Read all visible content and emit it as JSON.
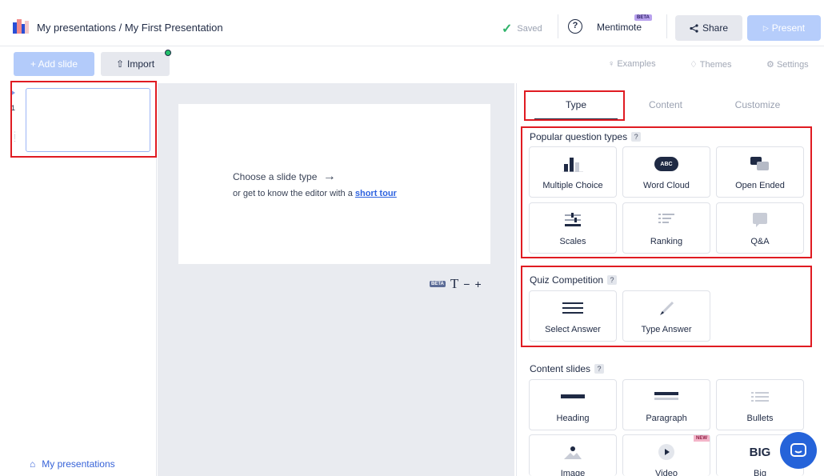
{
  "header": {
    "breadcrumb": "My presentations / My First Presentation",
    "saved_label": "Saved",
    "help_symbol": "?",
    "mentimote_label": "Mentimote",
    "mentimote_badge": "BETA",
    "share_label": "Share",
    "present_label": "Present"
  },
  "toolbar": {
    "add_slide_label": "+ Add slide",
    "import_label": "Import",
    "examples_label": "Examples",
    "themes_label": "Themes",
    "settings_label": "Settings"
  },
  "slides": {
    "current_number": "1",
    "footer_link": "My presentations"
  },
  "canvas": {
    "choose_text": "Choose a slide type",
    "tour_prefix": "or get to know the editor with a",
    "tour_link": "short tour",
    "zoom_badge": "BETA",
    "zoom_text_symbol": "T",
    "zoom_minus": "−",
    "zoom_plus": "+"
  },
  "tabs": [
    {
      "label": "Type",
      "active": true
    },
    {
      "label": "Content",
      "active": false
    },
    {
      "label": "Customize",
      "active": false
    }
  ],
  "sections": {
    "popular": {
      "title": "Popular question types",
      "help": "?",
      "cards": [
        {
          "label": "Multiple Choice",
          "icon": "bar-chart-icon"
        },
        {
          "label": "Word Cloud",
          "icon": "word-cloud-icon"
        },
        {
          "label": "Open Ended",
          "icon": "speech-bubbles-icon"
        },
        {
          "label": "Scales",
          "icon": "scales-icon"
        },
        {
          "label": "Ranking",
          "icon": "ranking-icon"
        },
        {
          "label": "Q&A",
          "icon": "qa-icon"
        }
      ],
      "word_cloud_icon_text": "ABC"
    },
    "quiz": {
      "title": "Quiz Competition",
      "help": "?",
      "cards": [
        {
          "label": "Select Answer",
          "icon": "list-lines-icon"
        },
        {
          "label": "Type Answer",
          "icon": "pencil-icon"
        }
      ]
    },
    "content": {
      "title": "Content slides",
      "help": "?",
      "cards": [
        {
          "label": "Heading",
          "icon": "heading-icon"
        },
        {
          "label": "Paragraph",
          "icon": "paragraph-icon"
        },
        {
          "label": "Bullets",
          "icon": "bullets-icon"
        },
        {
          "label": "Image",
          "icon": "image-icon"
        },
        {
          "label": "Video",
          "icon": "play-icon",
          "badge": "NEW"
        },
        {
          "label": "Big",
          "icon": "big-text-icon",
          "icon_text": "BIG"
        }
      ]
    }
  },
  "colors": {
    "accent_blue": "#2563d9",
    "highlight_red": "#e01b22",
    "saved_green": "#2fb36a"
  }
}
